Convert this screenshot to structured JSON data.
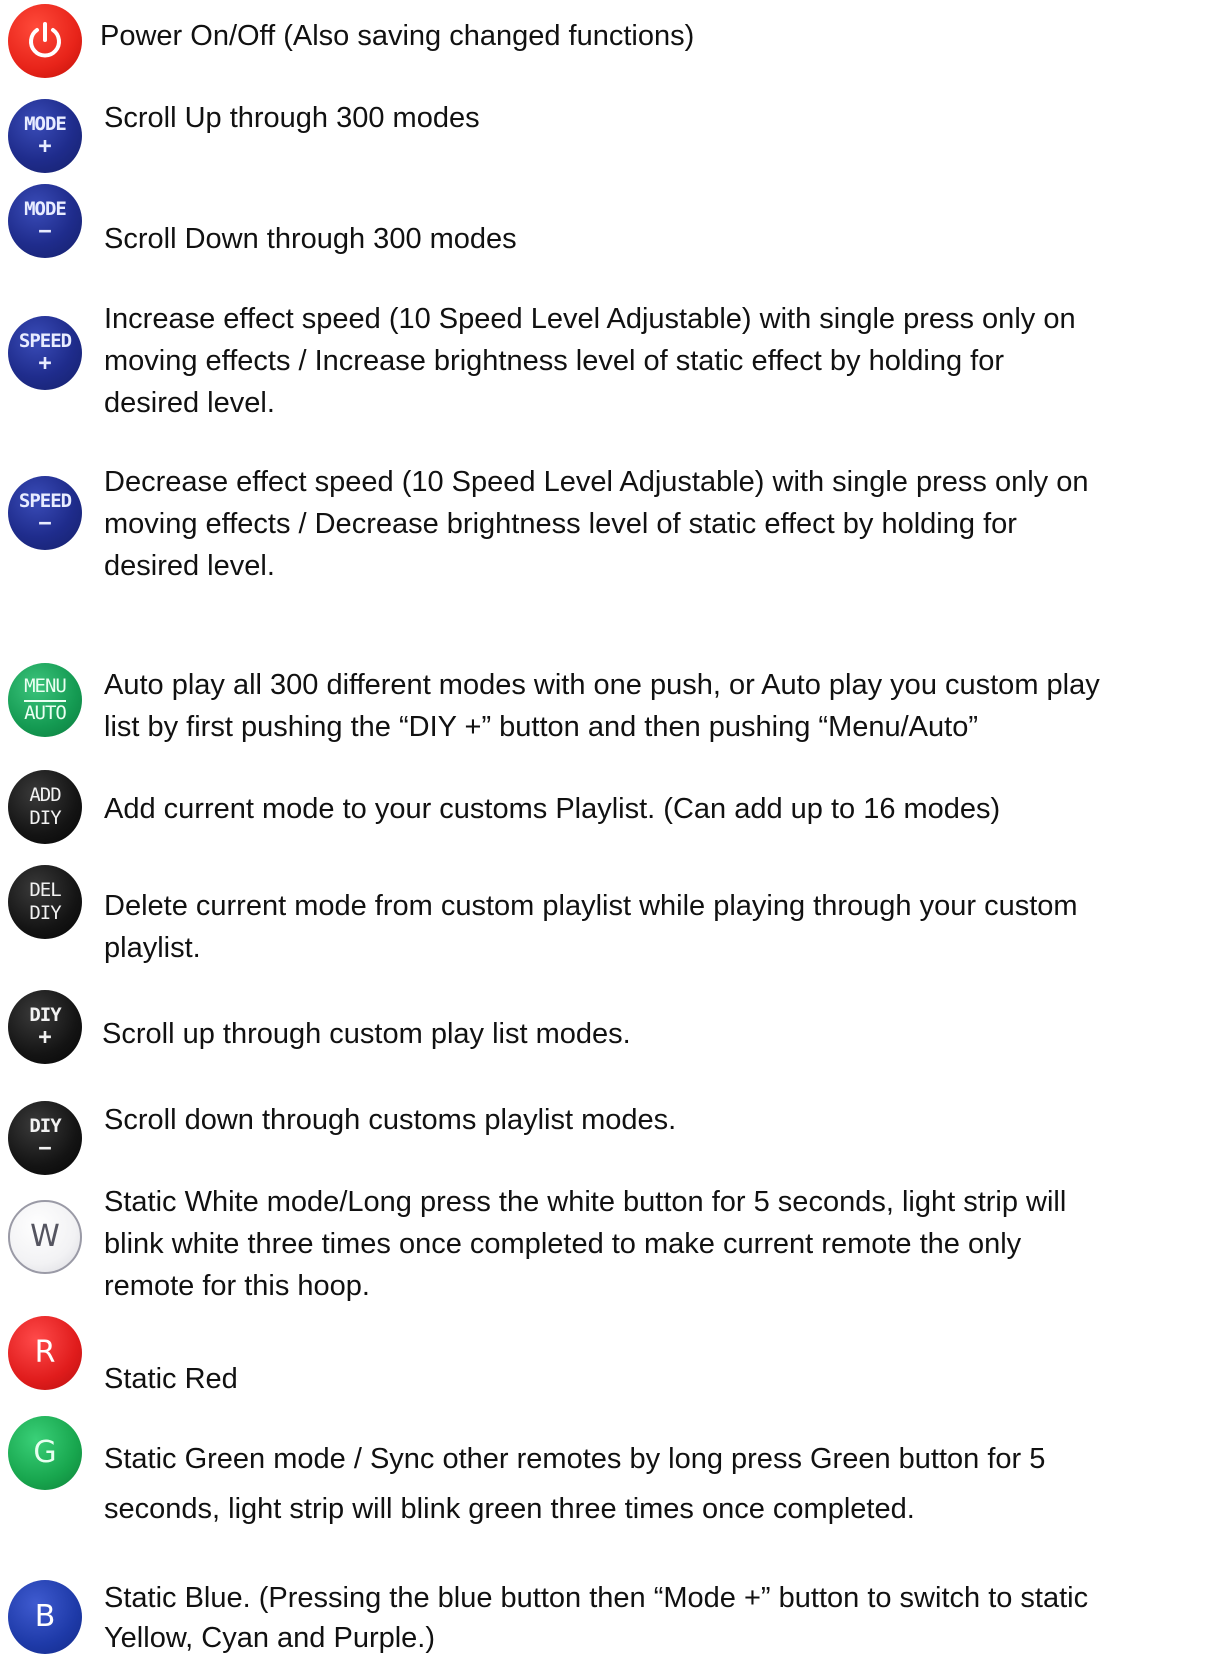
{
  "colors": {
    "mode_blue": "#1f2c8c",
    "diy_black": "#141414",
    "menu_green": "#149a52",
    "red": "#e01c1c",
    "green": "#18a64e",
    "blue": "#1e3aa8",
    "white": "#f2f2f4"
  },
  "buttons": [
    {
      "icon": "power-icon",
      "line1": "",
      "line2": "",
      "description": "Power On/Off (Also saving changed functions)"
    },
    {
      "icon": "mode-plus-icon",
      "line1": "MODE",
      "line2": "+",
      "description": "Scroll Up through 300 modes"
    },
    {
      "icon": "mode-minus-icon",
      "line1": "MODE",
      "line2": "−",
      "description": "Scroll Down through 300 modes"
    },
    {
      "icon": "speed-plus-icon",
      "line1": "SPEED",
      "line2": "+",
      "description": "Increase effect speed (10 Speed Level Adjustable) with single press only on\nmoving effects / Increase brightness level of static effect by holding for\ndesired level."
    },
    {
      "icon": "speed-minus-icon",
      "line1": "SPEED",
      "line2": "−",
      "description": "Decrease effect speed (10 Speed Level Adjustable) with single press only on\nmoving effects / Decrease brightness level of static effect by holding for\ndesired level."
    },
    {
      "icon": "menu-auto-icon",
      "line1": "MENU",
      "line2": "AUTO",
      "description": "Auto play all 300 different modes with one push, or Auto play you custom play\nlist by first pushing the “DIY +” button and then pushing  “Menu/Auto”"
    },
    {
      "icon": "add-diy-icon",
      "line1": "ADD",
      "line2": "DIY",
      "description": "Add current mode to your customs Playlist. (Can add up to 16 modes)"
    },
    {
      "icon": "del-diy-icon",
      "line1": "DEL",
      "line2": "DIY",
      "description": "Delete current mode from custom playlist while playing through your custom\nplaylist."
    },
    {
      "icon": "diy-plus-icon",
      "line1": "DIY",
      "line2": "+",
      "description": "Scroll up through custom play list modes."
    },
    {
      "icon": "diy-minus-icon",
      "line1": "DIY",
      "line2": "−",
      "description": "Scroll down through customs playlist modes."
    },
    {
      "icon": "white-button-icon",
      "line1": "W",
      "line2": "",
      "description": "Static White mode/Long press the white button for 5 seconds, light strip will\nblink white three times once completed to make current remote the only\nremote for this hoop."
    },
    {
      "icon": "red-button-icon",
      "line1": "R",
      "line2": "",
      "description": "Static Red"
    },
    {
      "icon": "green-button-icon",
      "line1": "G",
      "line2": "",
      "description": "Static Green mode / Sync other remotes by long press Green button for 5\nseconds, light strip will blink green three times once completed."
    },
    {
      "icon": "blue-button-icon",
      "line1": "B",
      "line2": "",
      "description": "Static Blue. (Pressing the blue button then “Mode +” button to switch to static\nYellow, Cyan and Purple.)"
    }
  ]
}
